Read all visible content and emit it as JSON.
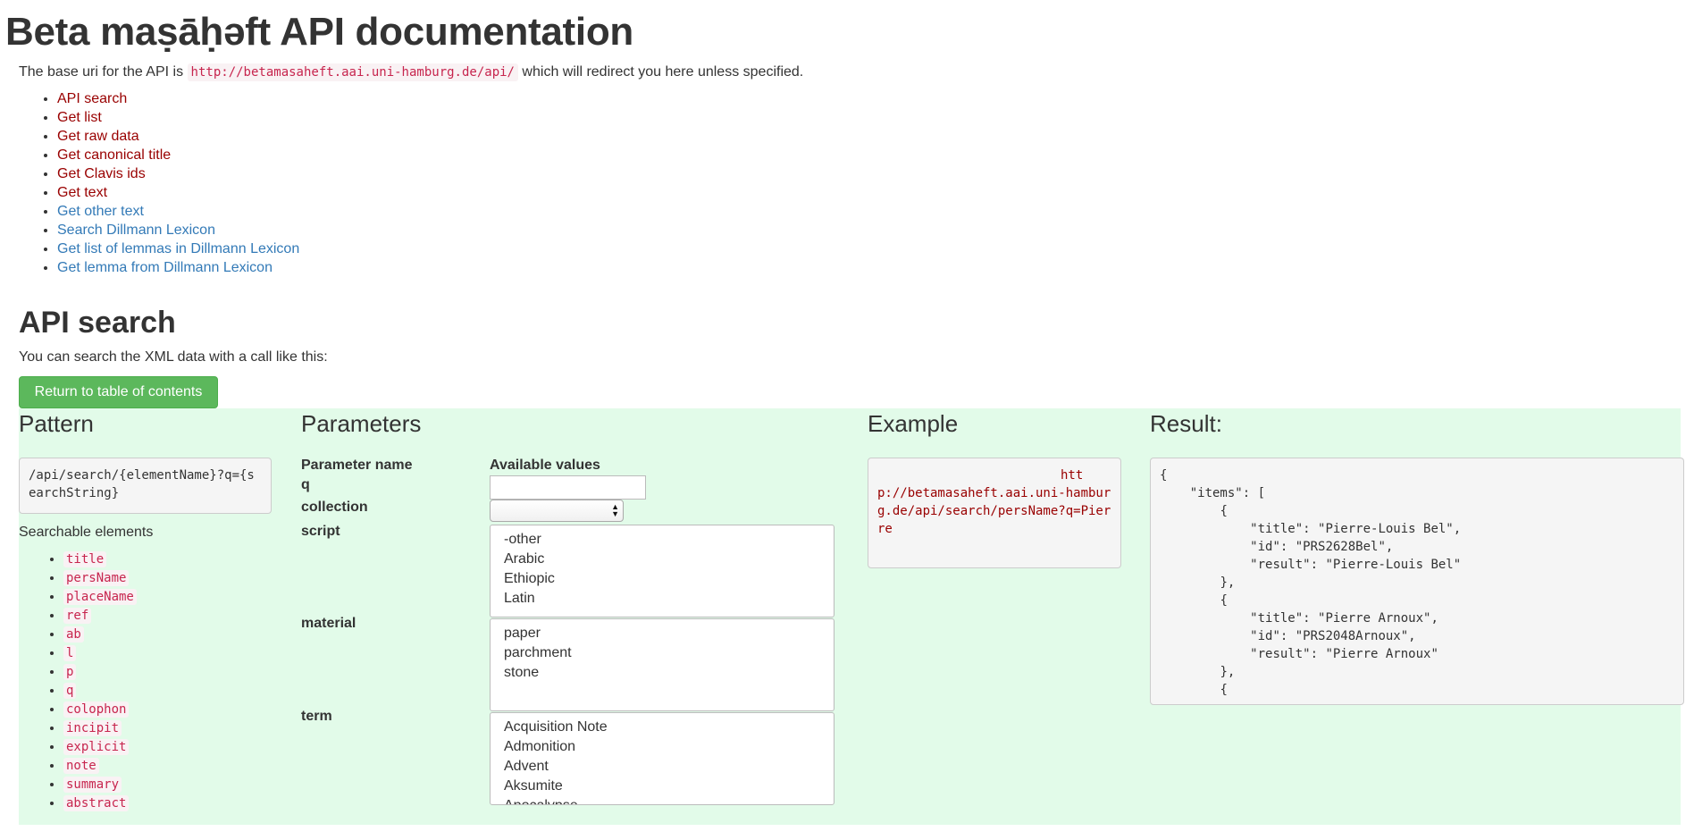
{
  "page": {
    "title": "Beta maṣāḥǝft API documentation",
    "intro_prefix": "The base uri for the API is ",
    "base_uri": "http://betamasaheft.aai.uni-hamburg.de/api/",
    "intro_suffix": " which will redirect you here unless specified."
  },
  "toc": [
    {
      "label": "API search",
      "color": "#990000"
    },
    {
      "label": "Get list",
      "color": "#990000"
    },
    {
      "label": "Get raw data",
      "color": "#990000"
    },
    {
      "label": "Get canonical title",
      "color": "#990000"
    },
    {
      "label": "Get Clavis ids",
      "color": "#990000"
    },
    {
      "label": "Get text",
      "color": "#990000"
    },
    {
      "label": "Get other text",
      "color": "#337ab7"
    },
    {
      "label": "Search Dillmann Lexicon",
      "color": "#337ab7"
    },
    {
      "label": "Get list of lemmas in Dillmann Lexicon",
      "color": "#337ab7"
    },
    {
      "label": "Get lemma from Dillmann Lexicon",
      "color": "#337ab7"
    }
  ],
  "section": {
    "title": "API search",
    "description": "You can search the XML data with a call like this:",
    "return_button": "Return to table of contents"
  },
  "pattern": {
    "heading": "Pattern",
    "code": "/api/search/{elementName}?q={searchString}",
    "searchable_label": "Searchable elements",
    "elements": [
      "title",
      "persName",
      "placeName",
      "ref",
      "ab",
      "l",
      "p",
      "q",
      "colophon",
      "incipit",
      "explicit",
      "note",
      "summary",
      "abstract"
    ]
  },
  "parameters": {
    "heading": "Parameters",
    "name_header": "Parameter name",
    "values_header": "Available values",
    "q_label": "q",
    "q_value": "",
    "collection_label": "collection",
    "collection_selected": "",
    "script_label": "script",
    "script_options": [
      "-other",
      "Arabic",
      "Ethiopic",
      "Latin"
    ],
    "material_label": "material",
    "material_options": [
      "paper",
      "parchment",
      "stone"
    ],
    "term_label": "term",
    "term_options": [
      "Acquisition Note",
      "Admonition",
      "Advent",
      "Aksumite",
      "Apocalypse"
    ]
  },
  "example": {
    "heading": "Example",
    "url": "http://betamasaheft.aai.uni-hamburg.de/api/search/persName?q=Pierre"
  },
  "result": {
    "heading": "Result:",
    "text": "{\n    \"items\": [\n        {\n            \"title\": \"Pierre-Louis Bel\",\n            \"id\": \"PRS2628Bel\",\n            \"result\": \"Pierre-Louis Bel\"\n        },\n        {\n            \"title\": \"Pierre Arnoux\",\n            \"id\": \"PRS2048Arnoux\",\n            \"result\": \"Pierre Arnoux\"\n        },\n        {"
  },
  "colors": {
    "panel_background": "#e2fbe9",
    "button_green": "#5cb85c",
    "link_red": "#990000",
    "link_blue": "#337ab7",
    "code_pink": "#c7254e"
  }
}
